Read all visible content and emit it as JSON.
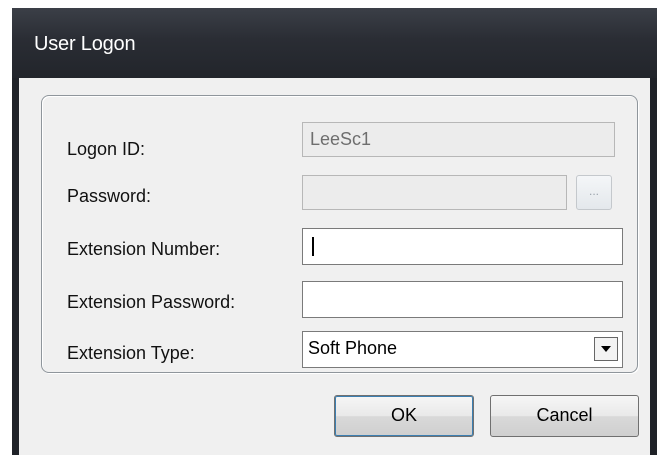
{
  "window": {
    "title": "User Logon"
  },
  "form": {
    "logon_id": {
      "label": "Logon ID:",
      "value": "LeeSc1"
    },
    "password": {
      "label": "Password:",
      "value": "",
      "browse_label": "..."
    },
    "extension_number": {
      "label": "Extension Number:",
      "value": ""
    },
    "extension_password": {
      "label": "Extension Password:",
      "value": ""
    },
    "extension_type": {
      "label": "Extension Type:",
      "selected": "Soft Phone"
    }
  },
  "buttons": {
    "ok": "OK",
    "cancel": "Cancel"
  }
}
